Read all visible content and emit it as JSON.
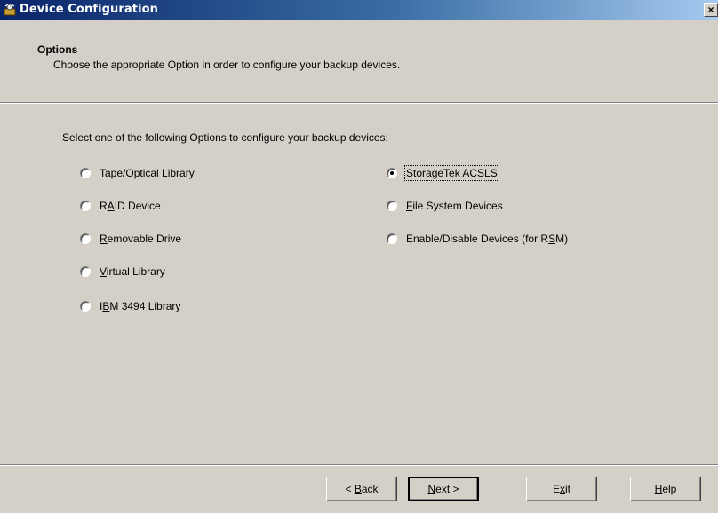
{
  "window": {
    "title": "Device Configuration",
    "close_glyph": "×"
  },
  "header": {
    "heading": "Options",
    "subtitle": "Choose the appropriate Option in order to configure your backup devices."
  },
  "main": {
    "prompt": "Select one of the following Options to configure your backup devices:",
    "selected": "storagetek-acsls",
    "options": [
      {
        "id": "tape-optical-library",
        "pre": "",
        "key": "T",
        "post": "ape/Optical Library",
        "checked": false
      },
      {
        "id": "raid-device",
        "pre": "R",
        "key": "A",
        "post": "ID Device",
        "checked": false
      },
      {
        "id": "removable-drive",
        "pre": "",
        "key": "R",
        "post": "emovable Drive",
        "checked": false
      },
      {
        "id": "virtual-library",
        "pre": "",
        "key": "V",
        "post": "irtual Library",
        "checked": false
      },
      {
        "id": "ibm-3494-library",
        "pre": "I",
        "key": "B",
        "post": "M 3494 Library",
        "checked": false
      },
      {
        "id": "storagetek-acsls",
        "pre": "",
        "key": "S",
        "post": "torageTek ACSLS",
        "checked": true
      },
      {
        "id": "file-system-devices",
        "pre": "",
        "key": "F",
        "post": "ile System Devices",
        "checked": false
      },
      {
        "id": "enable-disable-devices-rsm",
        "pre": "Enable/Disable Devices (for R",
        "key": "S",
        "post": "M)",
        "checked": false
      }
    ]
  },
  "footer": {
    "buttons": [
      {
        "id": "back",
        "pre": "< ",
        "key": "B",
        "post": "ack"
      },
      {
        "id": "next",
        "pre": "",
        "key": "N",
        "post": "ext >"
      },
      {
        "id": "exit",
        "pre": "E",
        "key": "x",
        "post": "it"
      },
      {
        "id": "help",
        "pre": "",
        "key": "H",
        "post": "elp"
      }
    ]
  }
}
